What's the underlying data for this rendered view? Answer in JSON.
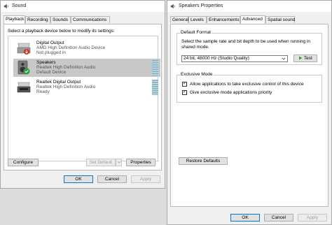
{
  "sound": {
    "title": "Sound",
    "tabs": [
      "Playback",
      "Recording",
      "Sounds",
      "Communications"
    ],
    "instruction": "Select a playback device below to modify its settings:",
    "devices": [
      {
        "name": "Digital Output",
        "sub": "AMD High Definition Audio Device",
        "status": "Not plugged in"
      },
      {
        "name": "Speakers",
        "sub": "Realtek High Definition Audio",
        "status": "Default Device"
      },
      {
        "name": "Realtek Digital Output",
        "sub": "Realtek High Definition Audio",
        "status": "Ready"
      }
    ],
    "configure_label": "Configure",
    "set_default_label": "Set Default",
    "properties_label": "Properties",
    "ok_label": "OK",
    "cancel_label": "Cancel",
    "apply_label": "Apply"
  },
  "speakers": {
    "title": "Speakers Properties",
    "tabs": [
      "General",
      "Levels",
      "Enhancements",
      "Advanced",
      "Spatial sound"
    ],
    "default_format": {
      "title": "Default Format",
      "description": "Select the sample rate and bit depth to be used when running in shared mode.",
      "selected": "24 bit, 48000 Hz (Studio Quality)",
      "test_label": "Test"
    },
    "exclusive_mode": {
      "title": "Exclusive Mode",
      "options": [
        {
          "label": "Allow applications to take exclusive control of this device",
          "checked": true
        },
        {
          "label": "Give exclusive mode applications priority",
          "checked": true
        }
      ]
    },
    "restore_label": "Restore Defaults",
    "ok_label": "OK",
    "cancel_label": "Cancel",
    "apply_label": "Apply"
  },
  "colors": {
    "accent": "#0078d7",
    "check_green": "#2e9e3e",
    "selection": "#c8c8c8"
  }
}
